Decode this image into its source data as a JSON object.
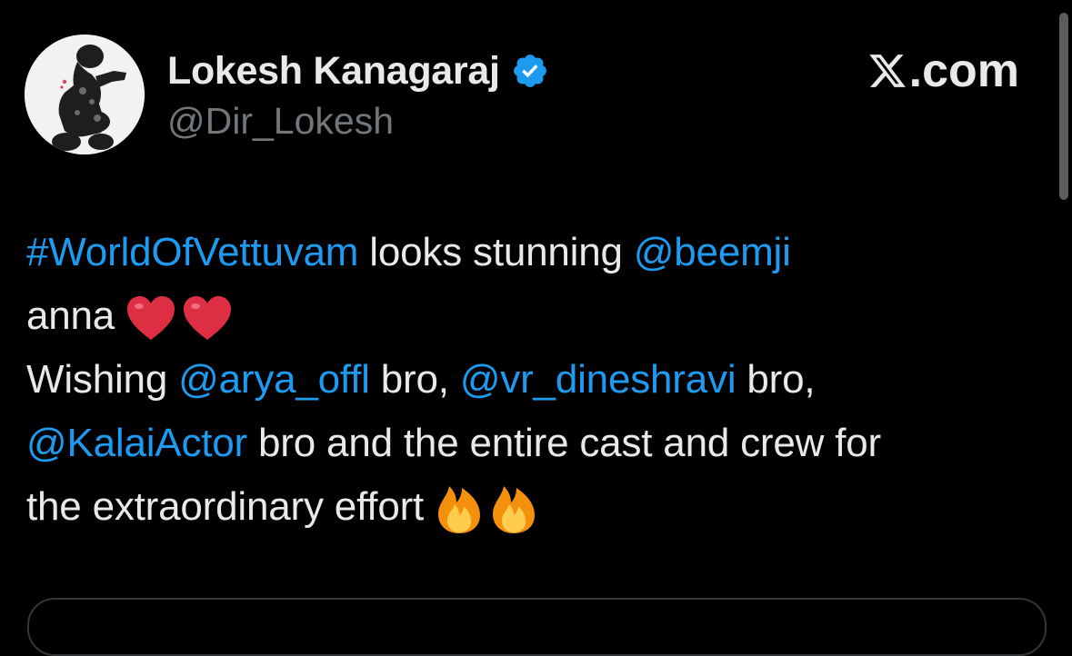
{
  "post": {
    "author": {
      "display_name": "Lokesh Kanagaraj",
      "handle": "@Dir_Lokesh",
      "verified_icon": "verified-badge-icon"
    },
    "brand": {
      "label": ".com",
      "icon": "x-logo-icon"
    },
    "text": {
      "hashtag": "#WorldOfVettuvam",
      "looks_stunning": " looks stunning ",
      "mention_beemji": "@beemji",
      "anna": "anna",
      "heart_emoji": "❤️",
      "wishing": "Wishing ",
      "mention_arya": "@arya_offl",
      "bro_comma_1": " bro, ",
      "mention_dinesh": "@vr_dineshravi",
      "bro_comma_2": " bro,",
      "mention_kalai": "@KalaiActor",
      "rest_line": " bro and the entire cast and crew for",
      "last_line": "the extraordinary effort",
      "fire_emoji": "🔥"
    }
  },
  "colors": {
    "background": "#000000",
    "text": "#e7e9ea",
    "link": "#1d9bf0",
    "secondary": "#71767b",
    "verified": "#1d9bf0"
  }
}
